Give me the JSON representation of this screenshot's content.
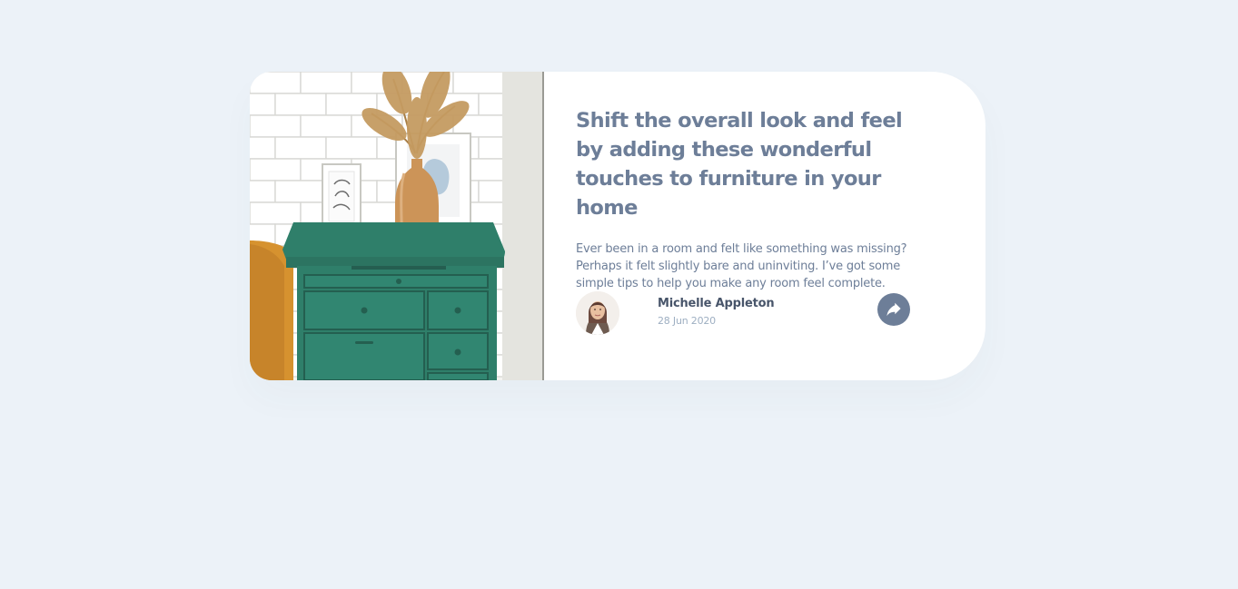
{
  "article": {
    "title": "Shift the overall look and feel by adding these wonderful touches to furniture in your home",
    "excerpt": "Ever been in a room and felt like something was missing? Perhaps it felt slightly bare and uninviting. I’ve got some simple tips to help you make any room feel complete.",
    "image_icon": "drawers-photo"
  },
  "author": {
    "name": "Michelle Appleton",
    "date": "28 Jun 2020",
    "avatar_icon": "avatar-photo"
  },
  "share": {
    "icon": "share-arrow-icon"
  },
  "colors": {
    "page_background": "#ecf2f8",
    "card_background": "#ffffff",
    "heading": "#6d7e98",
    "body_text": "#6d7e98",
    "author_name": "#48556a",
    "date_text": "#9eafc2",
    "share_button": "#6d7e98",
    "dresser_green": "#2f7f6a"
  }
}
